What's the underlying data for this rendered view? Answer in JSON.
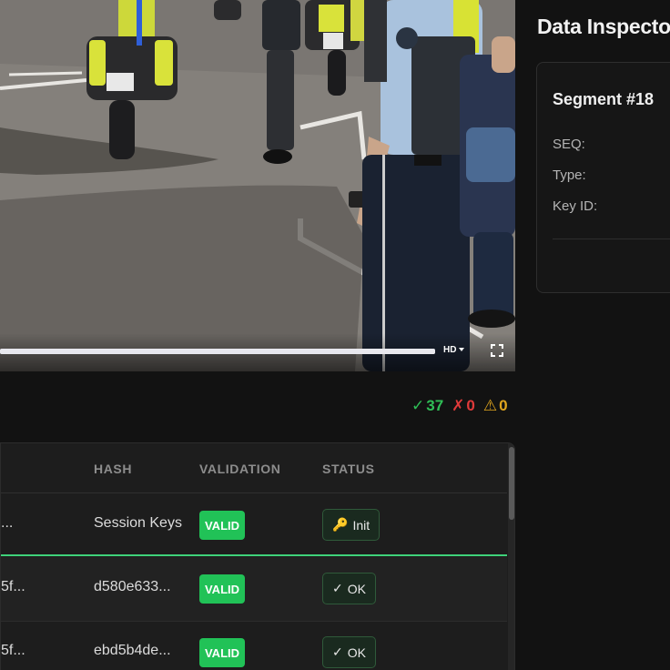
{
  "video": {
    "quality_label": "HD",
    "progress": 1.0
  },
  "inspector": {
    "title": "Data Inspector",
    "segment_title": "Segment #18",
    "fields": [
      "SEQ:",
      "Type:",
      "Key ID:"
    ]
  },
  "stats": {
    "valid": {
      "icon": "check-icon",
      "count": "37",
      "color": "#2fbf56"
    },
    "errors": {
      "icon": "x-icon",
      "count": "0",
      "color": "#e03a3a"
    },
    "warnings": {
      "icon": "warning-icon",
      "count": "0",
      "color": "#e0a51e"
    }
  },
  "table": {
    "columns": [
      "HASH",
      "VALIDATION",
      "STATUS"
    ],
    "rows": [
      {
        "id": "...",
        "hash": "Session Keys",
        "validation": "VALID",
        "status": "Init",
        "status_icon": "key-icon"
      },
      {
        "id": "5f...",
        "hash": "d580e633...",
        "validation": "VALID",
        "status": "OK",
        "status_icon": "check-icon"
      },
      {
        "id": "5f...",
        "hash": "ebd5b4de...",
        "validation": "VALID",
        "status": "OK",
        "status_icon": "check-icon"
      }
    ]
  }
}
